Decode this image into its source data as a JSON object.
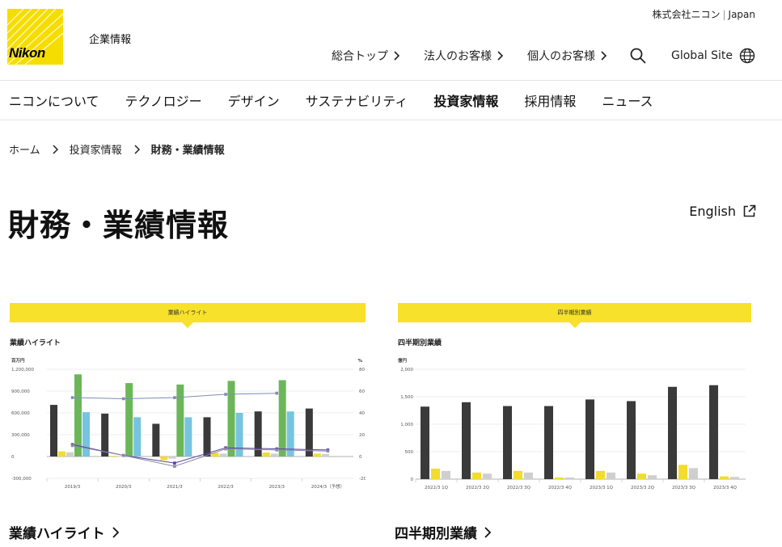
{
  "brand": {
    "logo_text": "Nikon",
    "section_label": "企業情報"
  },
  "top_right": {
    "company": "株式会社ニコン",
    "region": "Japan"
  },
  "util_nav": {
    "items": [
      "総合トップ",
      "法人のお客様",
      "個人のお客様"
    ],
    "global_site": "Global Site"
  },
  "main_nav": {
    "items": [
      "ニコンについて",
      "テクノロジー",
      "デザイン",
      "サステナビリティ",
      "投資家情報",
      "採用情報",
      "ニュース"
    ],
    "active": "投資家情報"
  },
  "breadcrumb": {
    "items": [
      "ホーム",
      "投資家情報",
      "財務・業績情報"
    ]
  },
  "page": {
    "title": "財務・業績情報",
    "english_link": "English"
  },
  "cards": [
    {
      "banner": "業績ハイライト",
      "chart_title": "業績ハイライト",
      "link_label": "業績ハイライト"
    },
    {
      "banner": "四半期別業績",
      "chart_title": "四半期別業績",
      "link_label": "四半期別業績"
    }
  ],
  "colors": {
    "brand_yellow": "#f6dd00",
    "banner_yellow": "#f7e12a",
    "bar_dark": "#3a3a3a",
    "bar_green": "#6cb65a",
    "bar_blue": "#76c4e0",
    "bar_yellow": "#f3dc2a",
    "bar_gray": "#cfcfcf",
    "line_blue": "#7d8eb0",
    "line_purple": "#5a3fa0",
    "line_gray": "#8a8aa8"
  },
  "chart_data": [
    {
      "type": "bar",
      "title": "業績ハイライト",
      "y_unit_left": "百万円",
      "y_unit_right": "%",
      "ylim": [
        -300000,
        1200000
      ],
      "yticks_left": [
        "1,200,000",
        "900,000",
        "600,000",
        "300,000",
        "0",
        "-300,000"
      ],
      "ylim_right": [
        -20,
        80
      ],
      "yticks_right": [
        "80",
        "60",
        "40",
        "20",
        "0",
        "-20"
      ],
      "categories": [
        "2019/3",
        "2020/3",
        "2021/3",
        "2022/3",
        "2023/3",
        "2024/3（予想）"
      ],
      "series": [
        {
          "values": [
            710000,
            590000,
            450000,
            540000,
            620000,
            660000
          ]
        },
        {
          "values": [
            1130000,
            1010000,
            990000,
            1040000,
            1050000,
            null
          ]
        },
        {
          "values": [
            610000,
            540000,
            540000,
            600000,
            620000,
            null
          ]
        },
        {
          "values": [
            70000,
            10000,
            -50000,
            50000,
            55000,
            40000
          ]
        },
        {
          "values": [
            60000,
            5000,
            -30000,
            40000,
            40000,
            35000
          ]
        }
      ],
      "lines": [
        {
          "values": [
            54,
            53,
            54,
            57,
            58,
            null
          ]
        },
        {
          "values": [
            11,
            1,
            -6,
            8,
            7,
            6
          ]
        },
        {
          "values": [
            10,
            1,
            -9,
            7,
            6,
            5
          ]
        }
      ],
      "grid": true
    },
    {
      "type": "bar",
      "title": "四半期別業績",
      "y_unit": "億円",
      "ylim": [
        0,
        2000
      ],
      "yticks": [
        "2,000",
        "1,500",
        "1,000",
        "500",
        "0"
      ],
      "categories": [
        "2022/3 1Q",
        "2022/3 2Q",
        "2022/3 3Q",
        "2022/3 4Q",
        "2023/3 1Q",
        "2023/3 2Q",
        "2023/3 3Q",
        "2023/3 4Q"
      ],
      "series": [
        {
          "values": [
            1320,
            1400,
            1330,
            1330,
            1450,
            1420,
            1680,
            1710
          ]
        },
        {
          "values": [
            190,
            120,
            150,
            30,
            150,
            100,
            260,
            50
          ]
        },
        {
          "values": [
            150,
            100,
            120,
            30,
            120,
            70,
            200,
            40
          ]
        }
      ],
      "grid": true
    }
  ]
}
